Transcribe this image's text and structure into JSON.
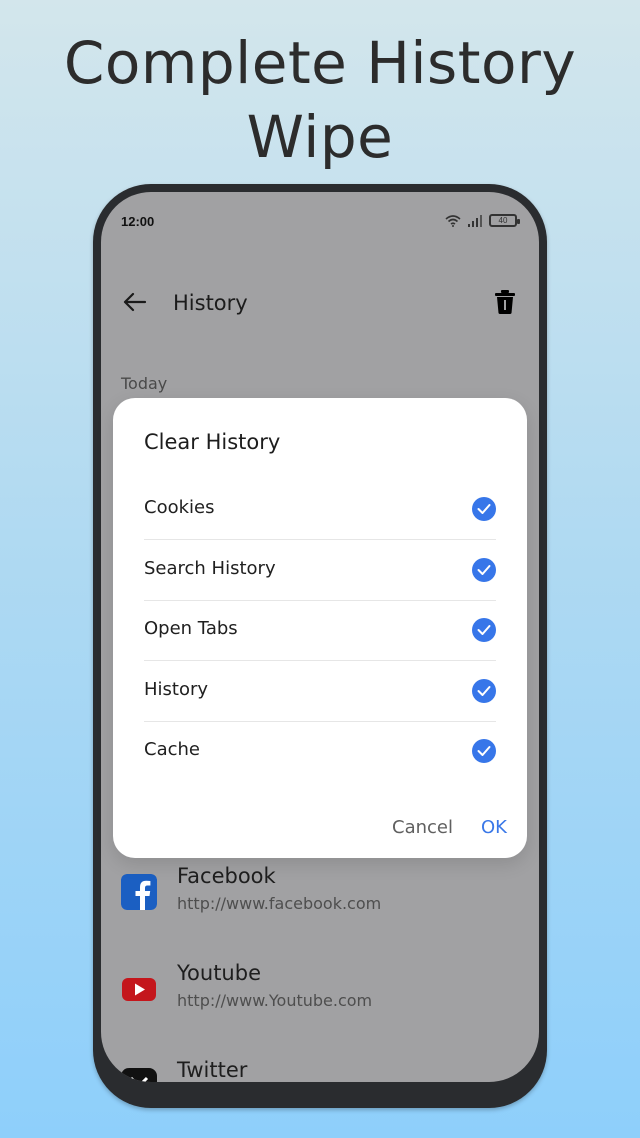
{
  "promo": {
    "headline_line1": "Complete History",
    "headline_line2": "Wipe"
  },
  "status_bar": {
    "time": "12:00",
    "battery": "40"
  },
  "app_bar": {
    "title": "History"
  },
  "section": {
    "label": "Today"
  },
  "dialog": {
    "title": "Clear History",
    "options": [
      {
        "label": "Cookies",
        "checked": true
      },
      {
        "label": "Search History",
        "checked": true
      },
      {
        "label": "Open Tabs",
        "checked": true
      },
      {
        "label": "History",
        "checked": true
      },
      {
        "label": "Cache",
        "checked": true
      }
    ],
    "cancel_label": "Cancel",
    "ok_label": "OK"
  },
  "history": [
    {
      "title": "Facebook",
      "url": "http://www.facebook.com",
      "icon": "facebook-icon"
    },
    {
      "title": "Youtube",
      "url": "http://www.Youtube.com",
      "icon": "youtube-icon"
    },
    {
      "title": "Twitter",
      "url": "",
      "icon": "x-icon"
    }
  ],
  "colors": {
    "accent": "#3776e9",
    "ok_button": "#3a78e8",
    "overlay": "#a1a1a3"
  }
}
